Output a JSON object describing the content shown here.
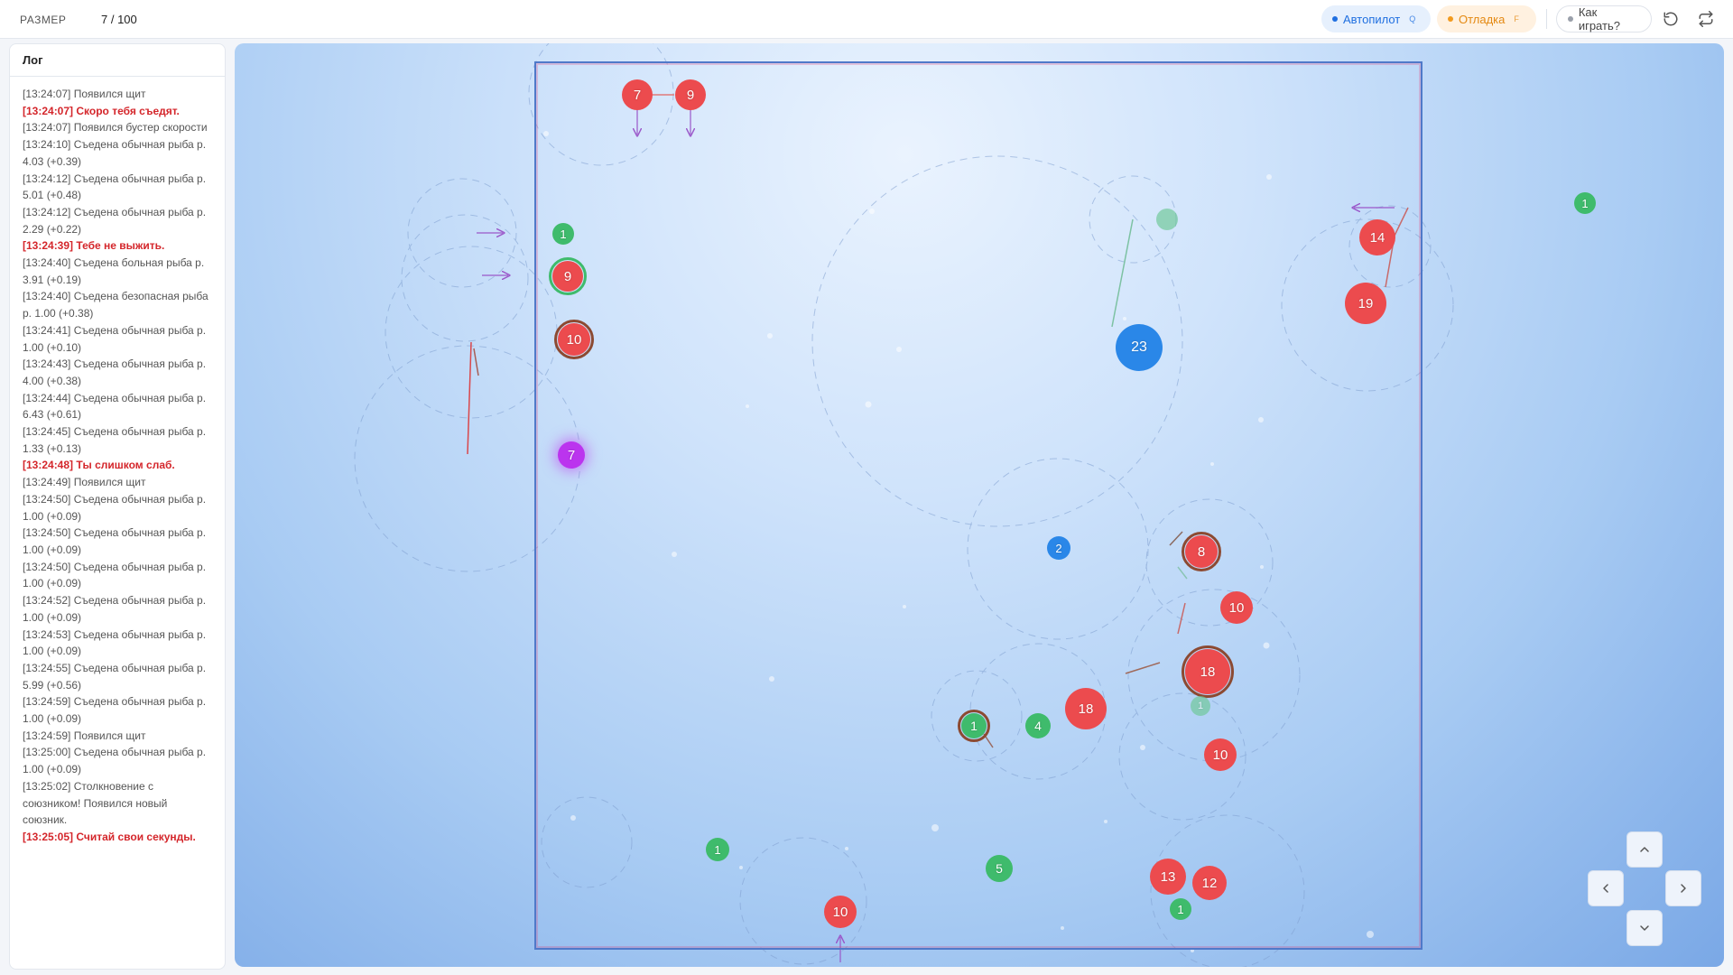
{
  "topbar": {
    "size_label": "РАЗМЕР",
    "size_value": "7 / 100",
    "autopilot": {
      "label": "Автопилот",
      "key": "Q",
      "color": "#1f6fe0"
    },
    "debug": {
      "label": "Отладка",
      "key": "F",
      "color": "#e48912"
    },
    "help": {
      "label": "Как играть?"
    },
    "restart_icon": "rotate-ccw-icon",
    "swap_icon": "repeat-icon"
  },
  "log": {
    "title": "Лог",
    "entries": [
      {
        "text": "[13:24:07] Появился щит",
        "alert": false
      },
      {
        "text": "[13:24:07] Скоро тебя съедят.",
        "alert": true
      },
      {
        "text": "[13:24:07] Появился бустер скорости",
        "alert": false
      },
      {
        "text": "[13:24:10] Съедена обычная рыба р. 4.03 (+0.39)",
        "alert": false
      },
      {
        "text": "[13:24:12] Съедена обычная рыба р. 5.01 (+0.48)",
        "alert": false
      },
      {
        "text": "[13:24:12] Съедена обычная рыба р. 2.29 (+0.22)",
        "alert": false
      },
      {
        "text": "[13:24:39] Тебе не выжить.",
        "alert": true
      },
      {
        "text": "[13:24:40] Съедена больная рыба р. 3.91 (+0.19)",
        "alert": false
      },
      {
        "text": "[13:24:40] Съедена безопасная рыба р. 1.00 (+0.38)",
        "alert": false
      },
      {
        "text": "[13:24:41] Съедена обычная рыба р. 1.00 (+0.10)",
        "alert": false
      },
      {
        "text": "[13:24:43] Съедена обычная рыба р. 4.00 (+0.38)",
        "alert": false
      },
      {
        "text": "[13:24:44] Съедена обычная рыба р. 6.43 (+0.61)",
        "alert": false
      },
      {
        "text": "[13:24:45] Съедена обычная рыба р. 1.33 (+0.13)",
        "alert": false
      },
      {
        "text": "[13:24:48] Ты слишком слаб.",
        "alert": true
      },
      {
        "text": "[13:24:49] Появился щит",
        "alert": false
      },
      {
        "text": "[13:24:50] Съедена обычная рыба р. 1.00 (+0.09)",
        "alert": false
      },
      {
        "text": "[13:24:50] Съедена обычная рыба р. 1.00 (+0.09)",
        "alert": false
      },
      {
        "text": "[13:24:50] Съедена обычная рыба р. 1.00 (+0.09)",
        "alert": false
      },
      {
        "text": "[13:24:52] Съедена обычная рыба р. 1.00 (+0.09)",
        "alert": false
      },
      {
        "text": "[13:24:53] Съедена обычная рыба р. 1.00 (+0.09)",
        "alert": false
      },
      {
        "text": "[13:24:55] Съедена обычная рыба р. 5.99 (+0.56)",
        "alert": false
      },
      {
        "text": "[13:24:59] Съедена обычная рыба р. 1.00 (+0.09)",
        "alert": false
      },
      {
        "text": "[13:24:59] Появился щит",
        "alert": false
      },
      {
        "text": "[13:25:00] Съедена обычная рыба р. 1.00 (+0.09)",
        "alert": false
      },
      {
        "text": "[13:25:02] Столкновение с союзником! Появился новый союзник.",
        "alert": false
      },
      {
        "text": "[13:25:05] Считай свои секунды.",
        "alert": true
      }
    ]
  },
  "colors": {
    "enemy": "#ec4b4e",
    "food": "#3fbb6c",
    "ally": "#2a87e8",
    "player": "#bb34ee",
    "arena_border": "#4f79c9"
  },
  "fish_labels": {
    "f1": "7",
    "f2": "9",
    "f3": "1",
    "f4": "9",
    "f5": "10",
    "f6": "7",
    "f7": "1",
    "f8": "14",
    "f9": "19",
    "f10": "23",
    "f11": "1",
    "f12": "2",
    "f13": "8",
    "f14": "10",
    "f15": "18",
    "f16": "1",
    "f17": "18",
    "f18": "4",
    "f19": "1",
    "f20": "10",
    "f21": "1",
    "f22": "10",
    "f23": "5",
    "f24": "13",
    "f25": "12",
    "f26": "1"
  },
  "controls": {
    "up_icon": "chevron-up-icon",
    "left_icon": "chevron-left-icon",
    "right_icon": "chevron-right-icon",
    "down_icon": "chevron-down-icon"
  }
}
